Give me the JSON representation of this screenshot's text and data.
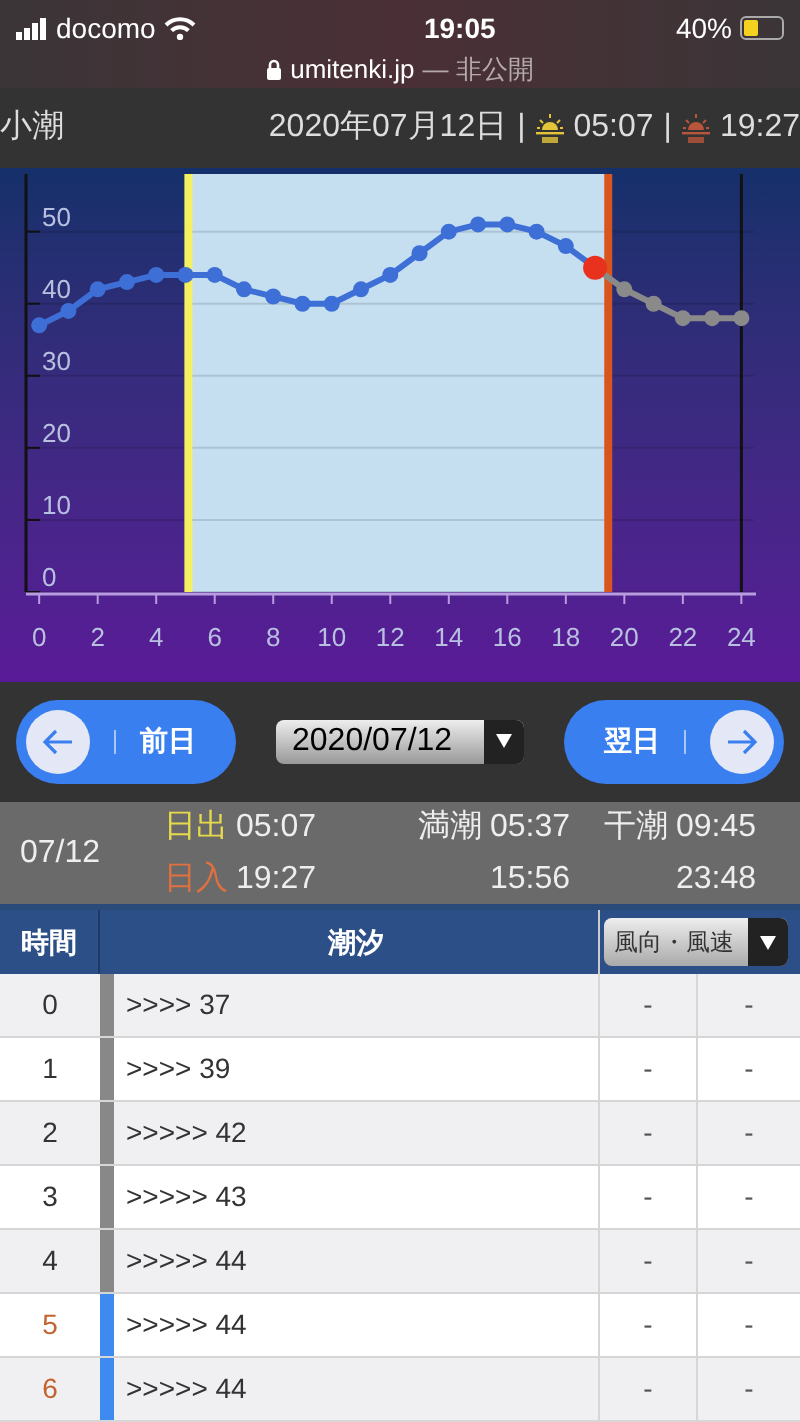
{
  "status_bar": {
    "carrier": "docomo",
    "time": "19:05",
    "battery": "40%",
    "url": "umitenki.jp",
    "privacy": "— 非公開"
  },
  "header": {
    "tide_type": "小潮",
    "date": "2020年07月12日",
    "separator": "|",
    "sunrise": "05:07",
    "sunset": "19:27"
  },
  "chart_data": {
    "type": "line",
    "x": [
      0,
      1,
      2,
      3,
      4,
      5,
      6,
      7,
      8,
      9,
      10,
      11,
      12,
      13,
      14,
      15,
      16,
      17,
      18,
      19,
      20,
      21,
      22,
      23,
      24
    ],
    "series": [
      {
        "color": "#3d6fd6",
        "marker": "circle",
        "values": [
          37,
          39,
          42,
          43,
          44,
          44,
          44,
          42,
          41,
          40,
          40,
          42,
          44,
          47,
          50,
          51,
          51,
          50,
          48,
          45,
          null,
          null,
          null,
          null,
          null
        ]
      },
      {
        "color": "#8a8a8a",
        "marker": "circle",
        "values": [
          null,
          null,
          null,
          null,
          null,
          null,
          null,
          null,
          null,
          null,
          null,
          null,
          null,
          null,
          null,
          null,
          null,
          null,
          null,
          45,
          42,
          40,
          38,
          38,
          38
        ]
      },
      {
        "color": "#e8321e",
        "marker": "circle",
        "values": [
          null,
          null,
          null,
          null,
          null,
          null,
          null,
          null,
          null,
          null,
          null,
          null,
          null,
          null,
          null,
          null,
          null,
          null,
          null,
          45,
          null,
          null,
          null,
          null,
          null
        ]
      }
    ],
    "xlim": [
      -0.45,
      24.5
    ],
    "ylim": [
      0,
      58
    ],
    "grid": true,
    "xticks": [
      0,
      2,
      4,
      6,
      8,
      10,
      12,
      14,
      16,
      18,
      20,
      22,
      24
    ],
    "yticks": [
      0,
      10,
      20,
      30,
      40,
      50
    ],
    "bands": [
      {
        "axis": "x",
        "from": 5.1,
        "to": 19.45,
        "color": "#c5dff0"
      }
    ],
    "ref_lines": [
      {
        "axis": "x",
        "value": 5.1,
        "color": "#f4f060"
      },
      {
        "axis": "x",
        "value": 19.45,
        "color": "#d9551e"
      },
      {
        "axis": "x",
        "value": 24,
        "color": "#111111"
      }
    ]
  },
  "nav": {
    "prev": "前日",
    "date": "2020/07/12",
    "next": "翌日"
  },
  "info": {
    "date": "07/12",
    "sunrise": {
      "label": "日出",
      "time": "05:07"
    },
    "sunset": {
      "label": "日入",
      "time": "19:27"
    },
    "high_tide": {
      "label": "満潮",
      "times": [
        "05:37",
        "15:56"
      ]
    },
    "low_tide": {
      "label": "干潮",
      "times": [
        "09:45",
        "23:48"
      ]
    }
  },
  "table": {
    "columns": [
      "時間",
      "潮汐"
    ],
    "wind_select": "風向・風速",
    "rows": [
      {
        "hour": "0",
        "tide": ">>>> 37",
        "wind_dir": "-",
        "wind_speed": "-",
        "daytime": false
      },
      {
        "hour": "1",
        "tide": ">>>> 39",
        "wind_dir": "-",
        "wind_speed": "-",
        "daytime": false
      },
      {
        "hour": "2",
        "tide": ">>>>> 42",
        "wind_dir": "-",
        "wind_speed": "-",
        "daytime": false
      },
      {
        "hour": "3",
        "tide": ">>>>> 43",
        "wind_dir": "-",
        "wind_speed": "-",
        "daytime": false
      },
      {
        "hour": "4",
        "tide": ">>>>> 44",
        "wind_dir": "-",
        "wind_speed": "-",
        "daytime": false
      },
      {
        "hour": "5",
        "tide": ">>>>> 44",
        "wind_dir": "-",
        "wind_speed": "-",
        "daytime": true
      },
      {
        "hour": "6",
        "tide": ">>>>> 44",
        "wind_dir": "-",
        "wind_speed": "-",
        "daytime": true
      }
    ]
  }
}
